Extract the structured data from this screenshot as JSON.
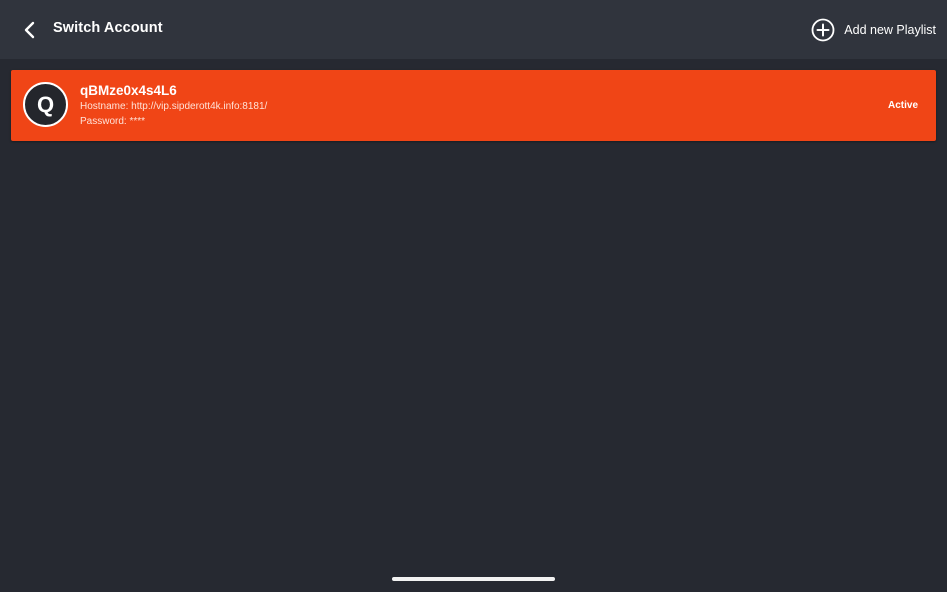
{
  "header": {
    "title": "Switch Account",
    "add_playlist_label": "Add new Playlist"
  },
  "accounts": [
    {
      "avatar_letter": "Q",
      "name": "qBMze0x4s4L6",
      "hostname_line": "Hostname: http://vip.sipderott4k.info:8181/",
      "password_line": "Password: ****",
      "status": "Active"
    }
  ],
  "icons": {
    "back": "back-arrow-icon",
    "add": "add-circle-icon"
  },
  "colors": {
    "background": "#262931",
    "topbar": "#30343d",
    "active_card": "#f04516",
    "avatar_bg": "#24262c"
  }
}
